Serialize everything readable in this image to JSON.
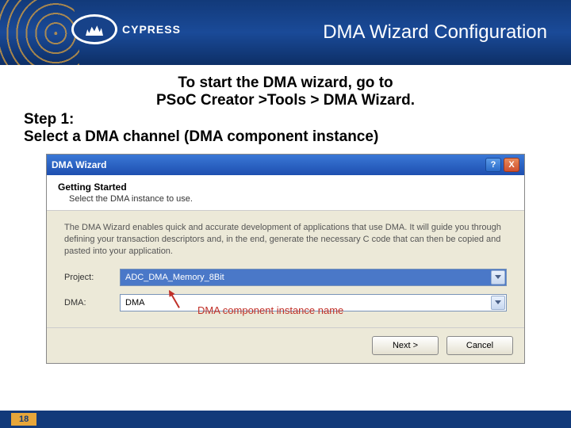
{
  "header": {
    "logo_text": "CYPRESS",
    "title": "DMA Wizard Configuration"
  },
  "content": {
    "intro_line1": "To start the DMA wizard, go to",
    "intro_line2": "PSoC Creator >Tools > DMA Wizard.",
    "step_label": "Step 1:",
    "step_text": "Select a DMA channel (DMA component instance)"
  },
  "wizard": {
    "window_title": "DMA Wizard",
    "header_title": "Getting Started",
    "header_sub": "Select the DMA instance to use.",
    "description": "The DMA Wizard enables quick and accurate development of applications that use DMA. It will guide you through defining your transaction descriptors and, in the end, generate the necessary C code that can then be copied and pasted into your application.",
    "project_label": "Project:",
    "project_value": "ADC_DMA_Memory_8Bit",
    "dma_label": "DMA:",
    "dma_value": "DMA",
    "callout": "DMA component instance name",
    "buttons": {
      "next": "Next >",
      "cancel": "Cancel"
    },
    "titlebar": {
      "help_glyph": "?",
      "close_glyph": "X"
    }
  },
  "footer": {
    "page_number": "18"
  }
}
